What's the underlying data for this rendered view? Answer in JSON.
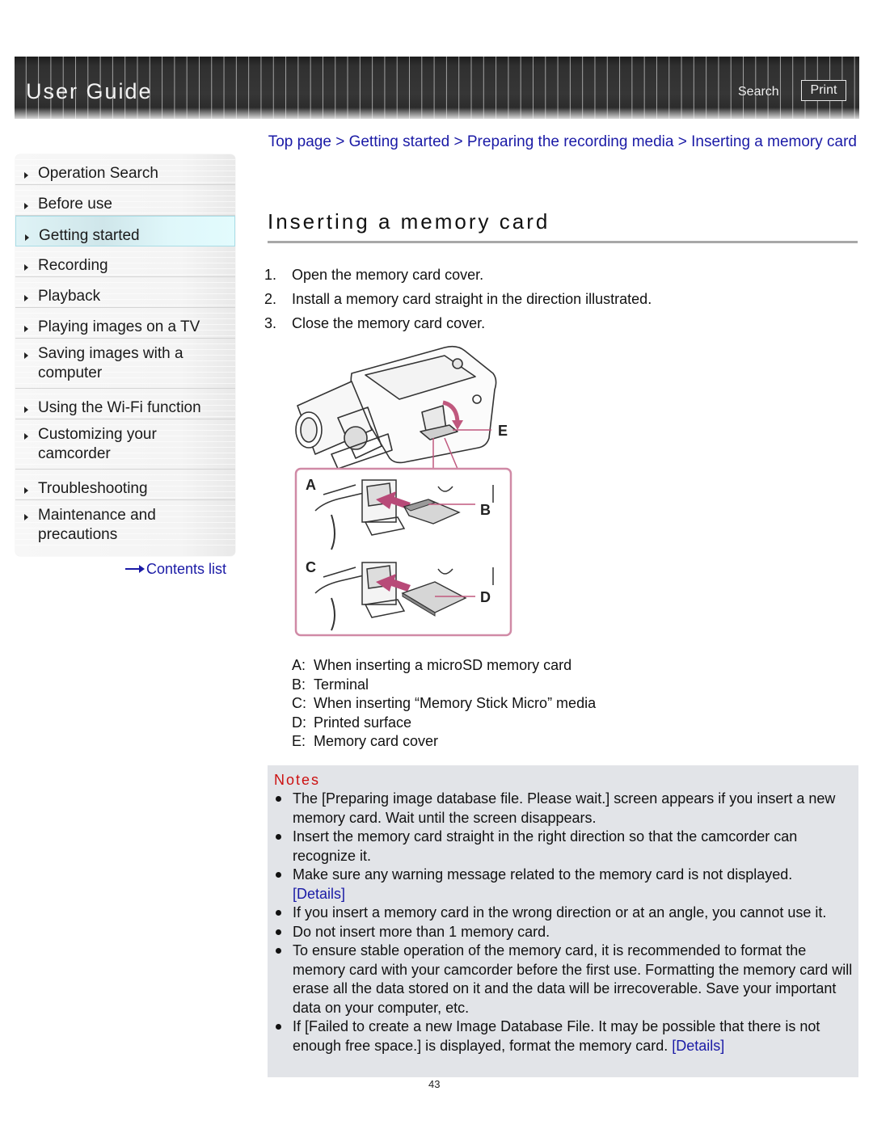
{
  "header": {
    "title": "User Guide",
    "search_label": "Search",
    "print_label": "Print"
  },
  "sidebar": {
    "items": [
      {
        "label": "Operation Search",
        "active": false
      },
      {
        "label": "Before use",
        "active": false
      },
      {
        "label": "Getting started",
        "active": true
      },
      {
        "label": "Recording",
        "active": false
      },
      {
        "label": "Playback",
        "active": false
      },
      {
        "label": "Playing images on a TV",
        "active": false
      },
      {
        "label": "Saving images with a computer",
        "active": false
      },
      {
        "label": "Using the Wi-Fi function",
        "active": false
      },
      {
        "label": "Customizing your camcorder",
        "active": false
      },
      {
        "label": "Troubleshooting",
        "active": false
      },
      {
        "label": "Maintenance and precautions",
        "active": false
      }
    ],
    "contents_link": "Contents list"
  },
  "breadcrumb": {
    "items": [
      "Top page",
      "Getting started",
      "Preparing the recording media",
      "Inserting a memory card"
    ],
    "separator": ">"
  },
  "main": {
    "title": "Inserting a memory card",
    "steps": [
      {
        "num": "1.",
        "text": "Open the memory card cover."
      },
      {
        "num": "2.",
        "text": "Install a memory card straight in the direction illustrated."
      },
      {
        "num": "3.",
        "text": "Close the memory card cover."
      }
    ],
    "illustration_labels": {
      "a": "A",
      "b": "B",
      "c": "C",
      "d": "D",
      "e": "E"
    },
    "legend": [
      {
        "key": "A:",
        "text": "When inserting a microSD memory card"
      },
      {
        "key": "B:",
        "text": "Terminal"
      },
      {
        "key": "C:",
        "text": "When inserting “Memory Stick Micro” media"
      },
      {
        "key": "D:",
        "text": "Printed surface"
      },
      {
        "key": "E:",
        "text": "Memory card cover"
      }
    ]
  },
  "notes": {
    "title": "Notes",
    "items": [
      {
        "text": "The [Preparing image database file. Please wait.] screen appears if you insert a new memory card. Wait until the screen disappears.",
        "link": ""
      },
      {
        "text": "Insert the memory card straight in the right direction so that the camcorder can recognize it.",
        "link": ""
      },
      {
        "text": "Make sure any warning message related to the memory card is not displayed. ",
        "link": "[Details]"
      },
      {
        "text": "If you insert a memory card in the wrong direction or at an angle, you cannot use it.",
        "link": ""
      },
      {
        "text": "Do not insert more than 1 memory card.",
        "link": ""
      },
      {
        "text": "To ensure stable operation of the memory card, it is recommended to format the memory card with your camcorder before the first use. Formatting the memory card will erase all the data stored on it and the data will be irrecoverable. Save your important data on your computer, etc.",
        "link": ""
      },
      {
        "text": "If [Failed to create a new Image Database File. It may be possible that there is not enough free space.] is displayed, format the memory card. ",
        "link": "[Details]"
      }
    ]
  },
  "footer": {
    "page_number": "43"
  },
  "colors": {
    "link": "#1a1aa6",
    "notes_title": "#cc1111",
    "notes_bg": "#e2e4e8",
    "header_bg": "#333333",
    "illustration_accent": "#c0587e"
  }
}
